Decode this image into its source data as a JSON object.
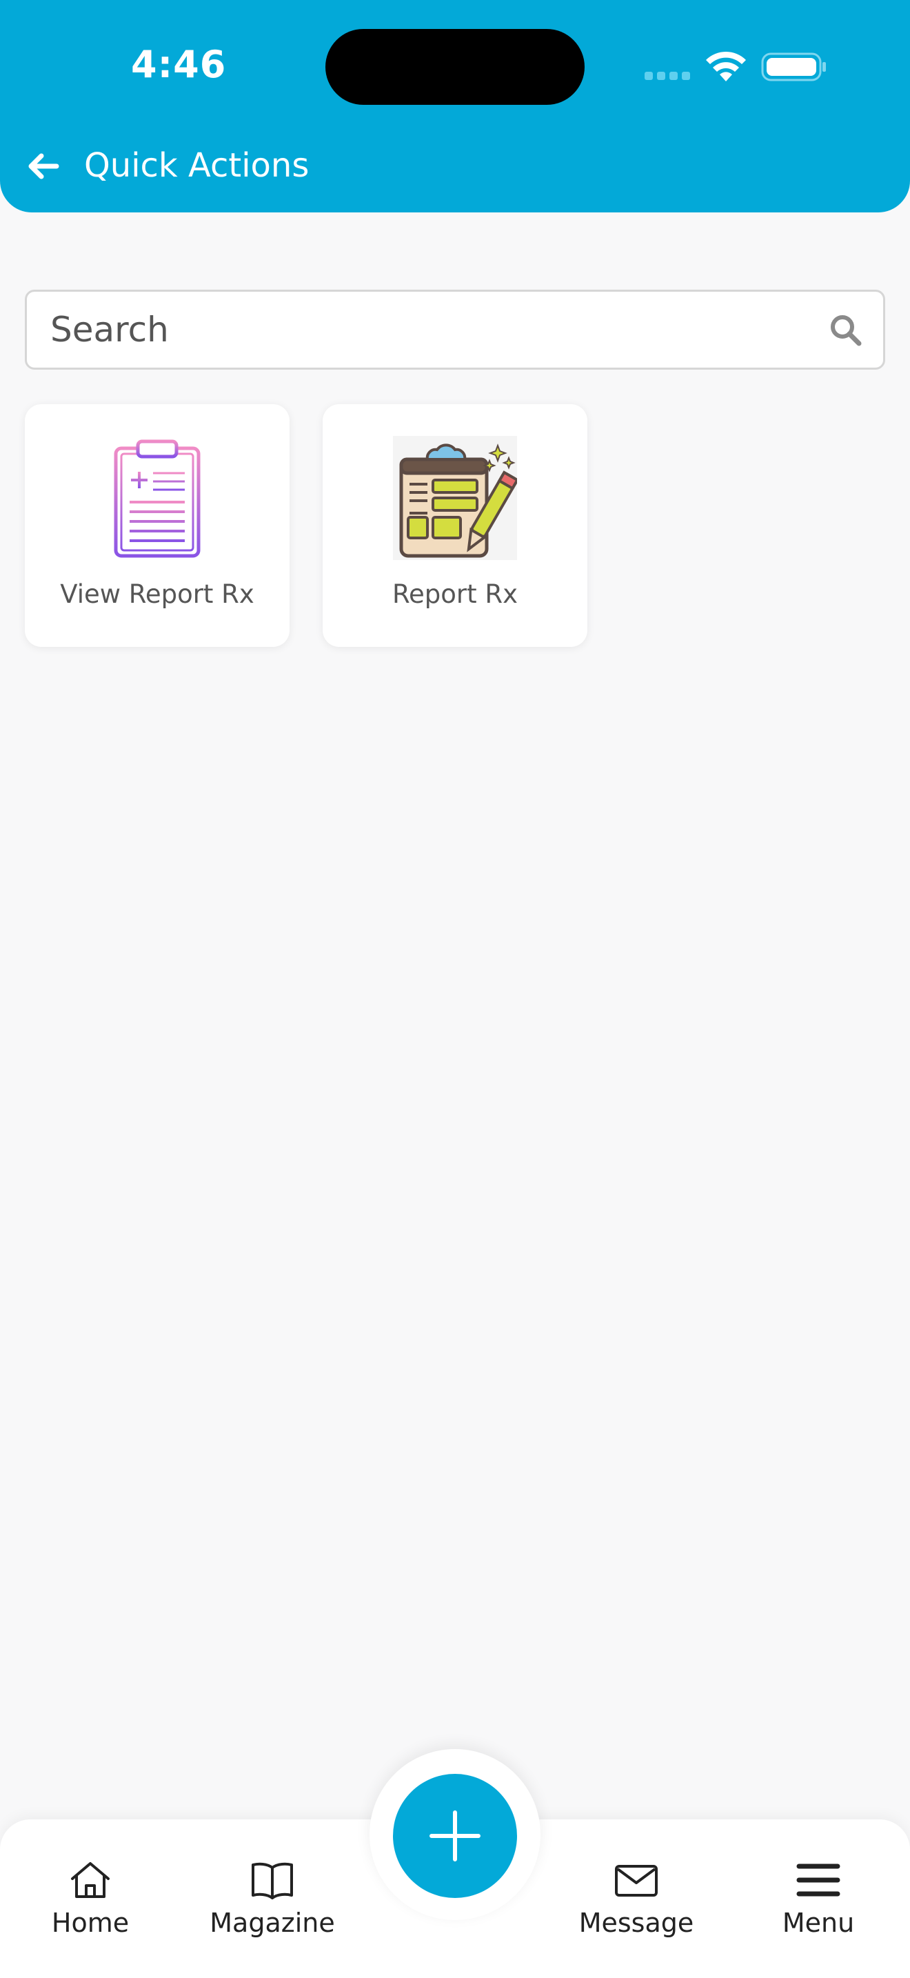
{
  "status_bar": {
    "time": "4:46"
  },
  "header": {
    "title": "Quick Actions"
  },
  "search": {
    "placeholder": "Search"
  },
  "cards": [
    {
      "label": "View Report Rx",
      "icon": "clipboard-medical-icon"
    },
    {
      "label": "Report Rx",
      "icon": "clipboard-pencil-icon"
    }
  ],
  "bottom_nav": {
    "items": [
      {
        "label": "Home",
        "icon": "home-icon"
      },
      {
        "label": "Magazine",
        "icon": "book-icon"
      },
      {
        "label": "Message",
        "icon": "mail-icon"
      },
      {
        "label": "Menu",
        "icon": "menu-icon"
      }
    ],
    "fab_icon": "plus-icon"
  },
  "colors": {
    "primary": "#03a9d8",
    "background": "#f8f8f9",
    "card": "#ffffff",
    "text": "#555555"
  }
}
